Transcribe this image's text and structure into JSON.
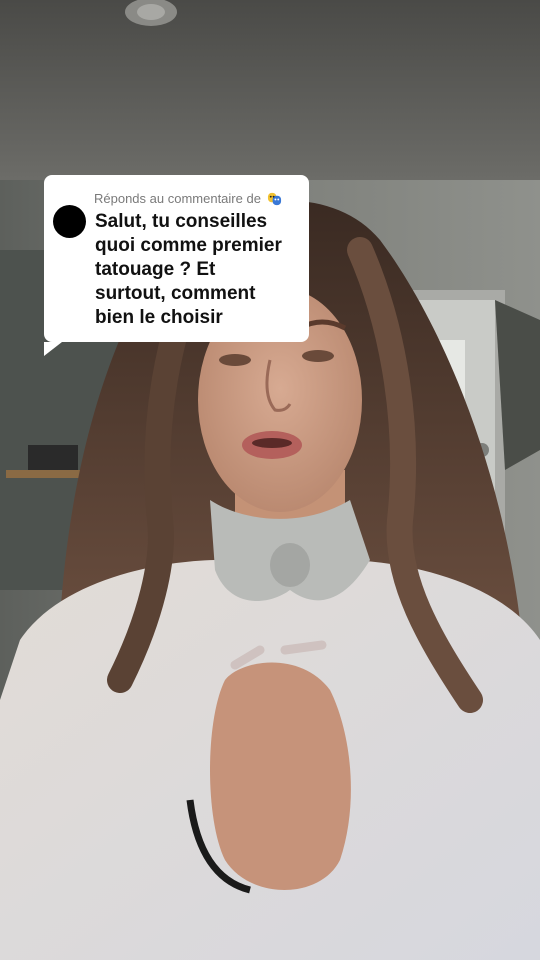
{
  "comment_reply": {
    "header": "Réponds au commentaire de",
    "header_emoji": "performing-arts-emoji",
    "avatar_color": "#000000",
    "text": "Salut, tu conseilles\nquoi comme premier\ntatouage ? Et\nsurtout, comment\nbien le choisir"
  },
  "video": {
    "description": "vertical selfie video frame"
  }
}
